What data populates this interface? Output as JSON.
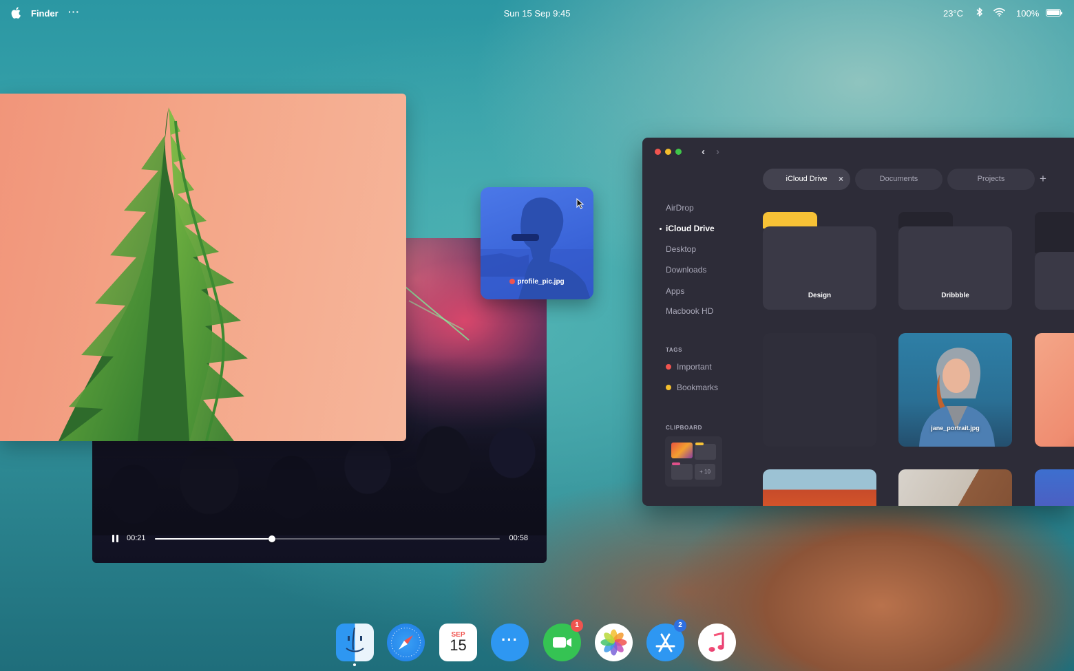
{
  "menubar": {
    "app_name": "Finder",
    "more": "···",
    "clock": "Sun 15 Sep 9:45",
    "temperature": "23°C",
    "battery_pct": "100%",
    "battery_level": 1.0,
    "icons": [
      "apple-icon",
      "bluetooth-icon",
      "wifi-icon",
      "battery-icon"
    ]
  },
  "video": {
    "current_time": "00:21",
    "total_time": "00:58",
    "progress": 0.34
  },
  "drag_file": {
    "name": "profile_pic.jpg",
    "tag_color": "#f0544f"
  },
  "finder": {
    "tabs": [
      {
        "label": "iCloud Drive",
        "active": true
      },
      {
        "label": "Documents",
        "active": false
      },
      {
        "label": "Projects",
        "active": false
      }
    ],
    "sidebar": [
      {
        "label": "AirDrop"
      },
      {
        "label": "iCloud Drive",
        "active": true
      },
      {
        "label": "Desktop"
      },
      {
        "label": "Downloads"
      },
      {
        "label": "Apps"
      },
      {
        "label": "Macbook HD"
      }
    ],
    "tags_title": "TAGS",
    "tags": [
      {
        "label": "Important",
        "color": "#f0544f"
      },
      {
        "label": "Bookmarks",
        "color": "#f3be2d"
      }
    ],
    "clipboard_title": "CLIPBOARD",
    "clipboard_more": "+ 10",
    "folders": [
      {
        "name": "Design",
        "flap_color": "#f7c236"
      },
      {
        "name": "Dribbble",
        "flap_color": "#25242e"
      }
    ],
    "files": [
      {
        "name": "jane_portrait.jpg"
      }
    ]
  },
  "dock": {
    "apps": [
      "finder-icon",
      "safari-icon",
      "calendar-icon",
      "messages-icon",
      "facetime-icon",
      "photos-icon",
      "app-store-icon",
      "music-icon"
    ],
    "calendar_month": "SEP",
    "calendar_day": "15",
    "facetime_badge": "1",
    "appstore_badge": "2"
  }
}
